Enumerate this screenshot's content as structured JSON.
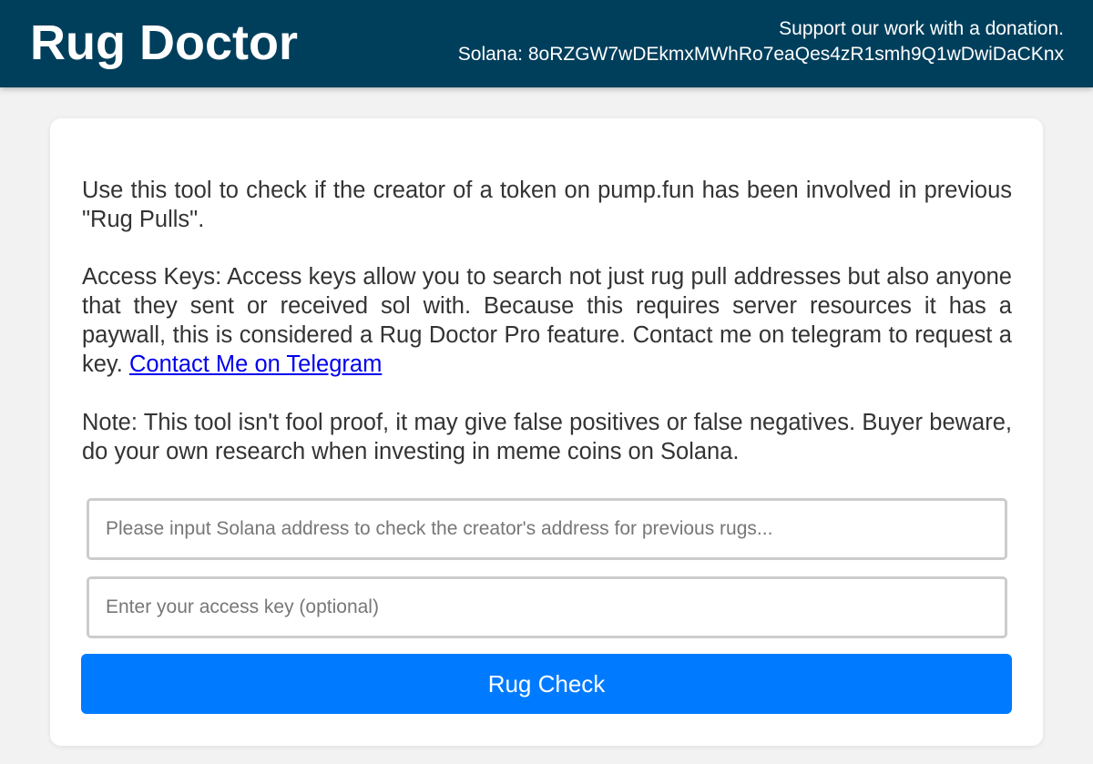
{
  "header": {
    "title": "Rug Doctor",
    "donation_line1": "Support our work with a donation.",
    "donation_line2": "Solana: 8oRZGW7wDEkmxMWhRo7eaQes4zR1smh9Q1wDwiDaCKnx",
    "background_color": "#003f5c"
  },
  "intro": {
    "text": "Use this tool to check if the creator of a token on pump.fun has been involved in previous \"Rug Pulls\"."
  },
  "access_keys": {
    "text": "Access Keys: Access keys allow you to search not just rug pull addresses but also anyone that they sent or received sol with. Because this requires server resources it has a paywall, this is considered a Rug Doctor Pro feature. Contact me on telegram to request a key. ",
    "link_label": "Contact Me on Telegram"
  },
  "note": {
    "text": "Note: This tool isn't fool proof, it may give false positives or false negatives. Buyer beware, do your own research when investing in meme coins on Solana."
  },
  "form": {
    "address_placeholder": "Please input Solana address to check the creator's address for previous rugs...",
    "address_value": "",
    "key_placeholder": "Enter your access key (optional)",
    "key_value": "",
    "submit_label": "Rug Check",
    "button_color": "#007bff"
  }
}
